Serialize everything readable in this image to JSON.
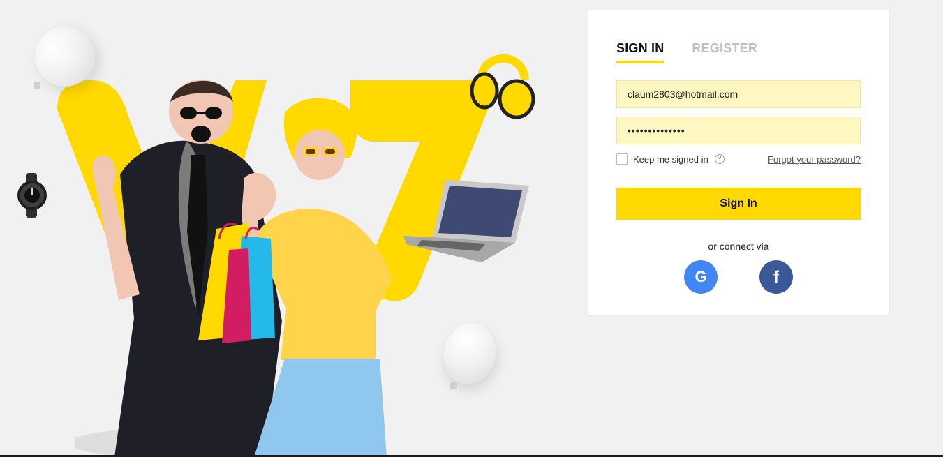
{
  "theme": {
    "accent": "#ffd900",
    "input_bg": "#fff7c2",
    "google": "#4285f4",
    "facebook": "#3b5998"
  },
  "auth": {
    "tabs": [
      {
        "label": "SIGN IN",
        "active": true
      },
      {
        "label": "REGISTER",
        "active": false
      }
    ],
    "email": {
      "value": "claum2803@hotmail.com"
    },
    "password": {
      "value": "••••••••••••••"
    },
    "keep_signed_in": {
      "label": "Keep me signed in",
      "checked": false
    },
    "help_icon": "question-circle-icon",
    "forgot_link": "Forgot your password?",
    "submit_label": "Sign In",
    "connect_label": "or connect via",
    "social": [
      {
        "name": "google",
        "icon": "google-icon",
        "glyph": "G"
      },
      {
        "name": "facebook",
        "icon": "facebook-icon",
        "glyph": "f"
      }
    ]
  },
  "hero": {
    "decorations": [
      "balloon-icon",
      "watch-icon",
      "headphones-icon",
      "laptop-icon",
      "shopping-bags-icon"
    ]
  }
}
